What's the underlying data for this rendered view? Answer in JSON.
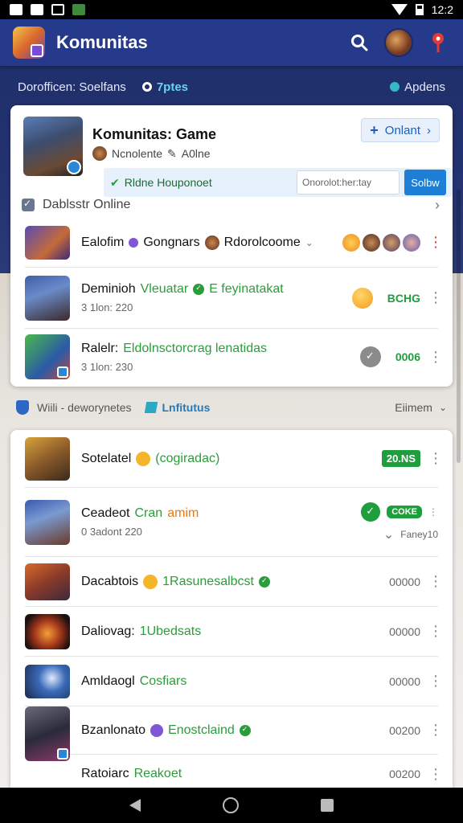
{
  "statusbar": {
    "time": "12:2"
  },
  "appbar": {
    "title": "Komunitas"
  },
  "tabs": [
    {
      "label": "Dorofficen: Soelfans"
    },
    {
      "label": "7ptes"
    },
    {
      "label": "Apdens"
    }
  ],
  "hero": {
    "title": "Komunitas: Game",
    "subtitle": "Ncnolente",
    "subtitle_tag": "A0lne",
    "online_button": "Onlant",
    "strip_label": "Rldne Houponoet",
    "strip_input": "Onorolot:her:tay",
    "strip_button": "Solbw"
  },
  "section1": {
    "title": "Dablsstr Online"
  },
  "list1": [
    {
      "title": "Ealofim",
      "title_2": "Gongnars",
      "title_3": "Rdorolcoome",
      "sub": ""
    },
    {
      "title": "Deminioh",
      "title_2": "Vleuatar",
      "title_3": "E feyinatakat",
      "sub": "3 1lon: 220",
      "right": "BCHG"
    },
    {
      "title": "Ralelr:",
      "title_2": "Eldolnsctorcrag lenatidas",
      "sub": "3 1lon: 230",
      "right": "0006"
    }
  ],
  "filter": {
    "left": "Wiili - deworynetes",
    "middle": "Lnfitutus",
    "right": "Eiimem"
  },
  "list2": [
    {
      "title": "Sotelatel",
      "title_2": "(cogiradac)",
      "right": "20.NS"
    },
    {
      "title": "Ceadeot",
      "title_2": "Cran",
      "title_3": "amim",
      "sub": "0 3adont 220",
      "right": "COKE",
      "right_sub": "Faney10"
    },
    {
      "title": "Dacabtois",
      "title_2": "1Rasunesalbcst",
      "right": "00000"
    },
    {
      "title": "Daliovag:",
      "title_2": "1Ubedsats",
      "right": "00000"
    },
    {
      "title": "Amldaogl",
      "title_2": "Cosfiars",
      "right": "00000"
    },
    {
      "title": "Bzanlonato",
      "title_2": "Enostclaind",
      "right": "00200"
    },
    {
      "title": "Ratoiarc",
      "title_2": "Reakoet",
      "right": "00200"
    }
  ],
  "colors": {
    "appbar": "#263a8c",
    "accent_blue": "#1f7ed6",
    "accent_green": "#1e9e3c",
    "accent_orange": "#e27a1a"
  }
}
